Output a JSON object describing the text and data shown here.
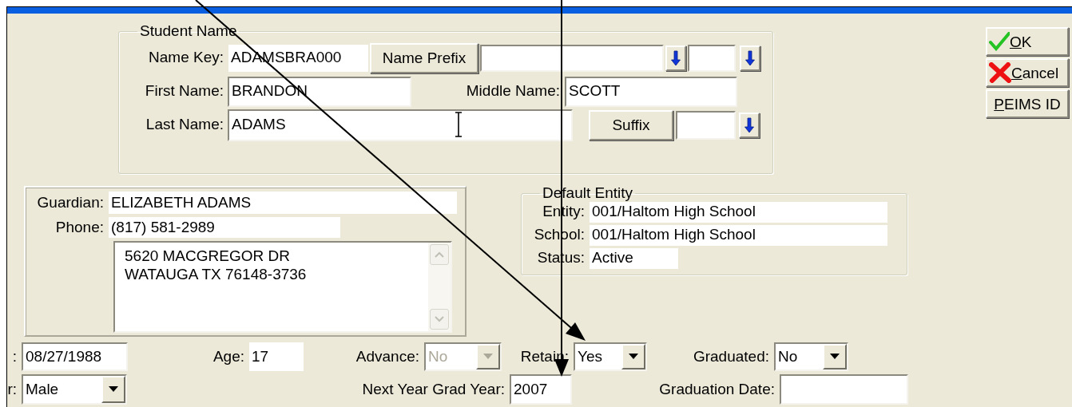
{
  "student_name": {
    "legend": "Student Name",
    "name_key": {
      "label": "Name Key:",
      "value": "ADAMSBRA000"
    },
    "name_prefix": {
      "button": "Name Prefix"
    },
    "first_name": {
      "label": "First Name:",
      "value": "BRANDON"
    },
    "middle_name": {
      "label": "Middle Name:",
      "value": "SCOTT"
    },
    "last_name": {
      "label": "Last Name:",
      "value": "ADAMS"
    },
    "suffix": {
      "button": "Suffix"
    }
  },
  "buttons": [
    {
      "label": "OK",
      "kind": "ok"
    },
    {
      "label": "Cancel",
      "kind": "cancel"
    },
    {
      "label": "PEIMS ID",
      "kind": "plain"
    }
  ],
  "guardian": {
    "guardian": {
      "label": "Guardian:",
      "value": "ELIZABETH ADAMS"
    },
    "phone": {
      "label": "Phone:",
      "value": "(817) 581-2989"
    },
    "address": [
      "5620 MACGREGOR DR",
      "WATAUGA TX 76148-3736"
    ]
  },
  "default_entity": {
    "legend": "Default Entity",
    "rows": [
      {
        "label": "Entity:",
        "value": "001/Haltom High School"
      },
      {
        "label": "School:",
        "value": "001/Haltom High School"
      },
      {
        "label": "Status:",
        "value": "Active"
      }
    ]
  },
  "details": [
    [
      {
        "kind": "field",
        "label": ":",
        "value": "08/27/1988"
      },
      {
        "kind": "readonly",
        "label": "Age:",
        "value": "17"
      },
      {
        "kind": "combo",
        "label": "Advance:",
        "value": "No",
        "disabled": true
      },
      {
        "kind": "combo",
        "label": "Retain:",
        "value": "Yes",
        "disabled": false
      },
      {
        "kind": "combo",
        "label": "Graduated:",
        "value": "No",
        "disabled": false
      }
    ],
    [
      {
        "kind": "combo",
        "label": "r:",
        "value": "Male",
        "disabled": false
      },
      {
        "kind": "field",
        "label": "Next Year Grad Year:",
        "value": "2007"
      },
      {
        "kind": "field",
        "label": "Graduation Date:"
      }
    ]
  ]
}
